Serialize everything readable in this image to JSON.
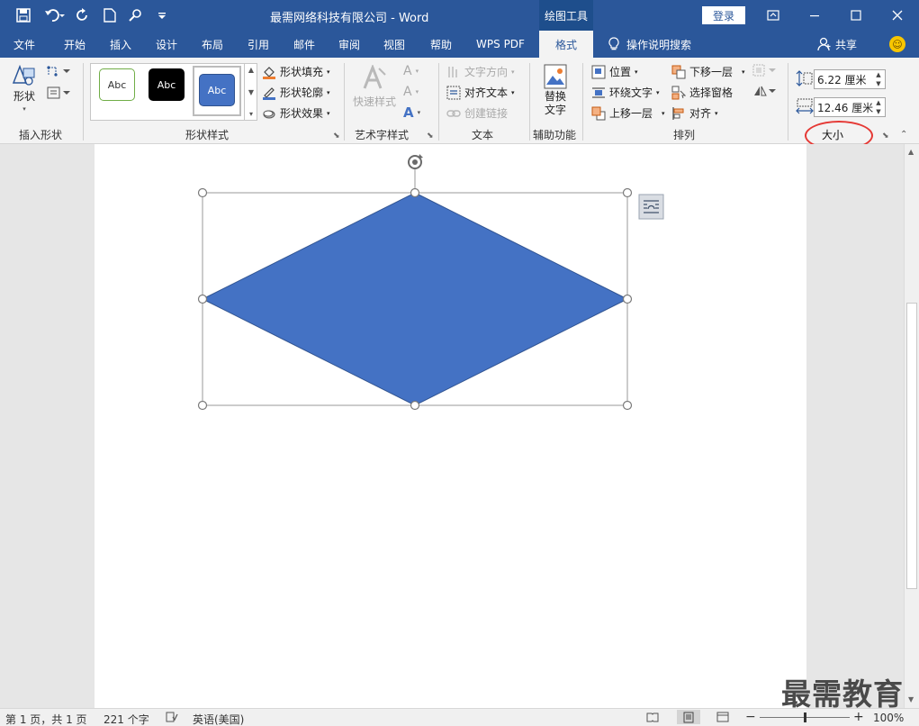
{
  "window": {
    "title": "最需网络科技有限公司 - Word",
    "contextual_tool": "绘图工具",
    "login_label": "登录"
  },
  "tabs": [
    "文件",
    "开始",
    "插入",
    "设计",
    "布局",
    "引用",
    "邮件",
    "审阅",
    "视图",
    "帮助",
    "WPS PDF",
    "格式"
  ],
  "active_tab": "格式",
  "tell_me": "操作说明搜索",
  "share": "共享",
  "ribbon": {
    "insert_shapes": {
      "shapes_label": "形状",
      "group": "插入形状"
    },
    "shape_styles": {
      "swatch_text": "Abc",
      "fill": "形状填充",
      "outline": "形状轮廓",
      "effects": "形状效果",
      "group": "形状样式"
    },
    "wordart": {
      "quick_styles": "快速样式",
      "group": "艺术字样式"
    },
    "text": {
      "direction": "文字方向",
      "align_text": "对齐文本",
      "create_link": "创建链接",
      "group": "文本"
    },
    "accessibility": {
      "alt_text_line1": "替换",
      "alt_text_line2": "文字",
      "group": "辅助功能"
    },
    "arrange": {
      "position": "位置",
      "wrap_text": "环绕文字",
      "bring_forward": "上移一层",
      "send_backward": "下移一层",
      "selection_pane": "选择窗格",
      "align": "对齐",
      "group": "排列"
    },
    "size": {
      "height": "6.22 厘米",
      "width": "12.46 厘米",
      "group": "大小"
    }
  },
  "shape": {
    "type": "diamond",
    "fill": "#4472c4",
    "stroke": "#2f528f"
  },
  "status": {
    "page": "第 1 页，共 1 页",
    "words": "221 个字",
    "language": "英语(美国)",
    "zoom": "100%",
    "zoom_fraction": 0.5
  },
  "watermark": "最需教育",
  "colors": {
    "brand": "#2b579a",
    "highlight": "#e53935"
  }
}
